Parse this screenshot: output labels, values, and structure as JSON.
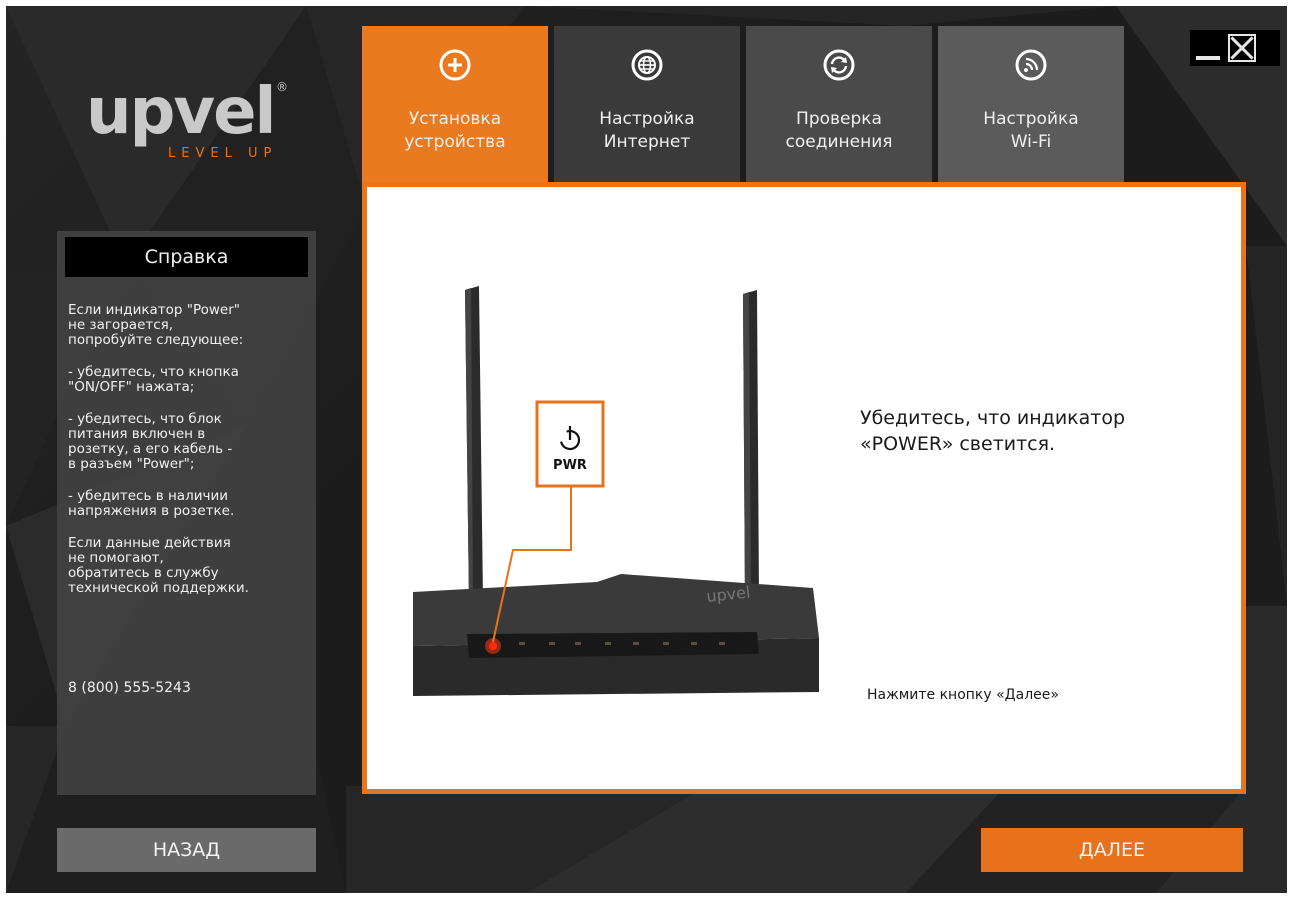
{
  "window": {
    "minimize_icon": "minimize-icon",
    "close_icon": "close-icon"
  },
  "logo": {
    "word": "upvel",
    "registered": "®",
    "tagline": "LEVEL UP"
  },
  "tabs": [
    {
      "line1": "Установка",
      "line2": "устройства",
      "icon": "plus-circle-icon",
      "active": true,
      "color": "#ea7a1f"
    },
    {
      "line1": "Настройка",
      "line2": "Интернет",
      "icon": "globe-icon",
      "active": false,
      "color": "#3a3a3a"
    },
    {
      "line1": "Проверка",
      "line2": "соединения",
      "icon": "refresh-icon",
      "active": false,
      "color": "#4a4a4a"
    },
    {
      "line1": "Настройка",
      "line2": "Wi-Fi",
      "icon": "wifi-icon",
      "active": false,
      "color": "#5b5b5b"
    }
  ],
  "help": {
    "title": "Справка",
    "paragraphs": [
      "Если индикатор \"Power\"\nне загорается,\nпопробуйте следующее:",
      "- убедитесь, что кнопка\n\"ON/OFF\" нажата;",
      "- убедитесь, что блок\nпитания включен в\nрозетку, а его кабель -\nв разъем \"Power\";",
      "- убедитесь в наличии\nнапряжения в розетке.",
      "Если данные действия\nне помогают,\nобратитесь в службу\nтехнической поддержки."
    ],
    "phone": "8 (800) 555-5243"
  },
  "content": {
    "router_label": "PWR",
    "router_brand": "upvel",
    "main_line1": "Убедитесь, что индикатор",
    "main_line2": "«POWER» светится.",
    "hint": "Нажмите кнопку «Далее»"
  },
  "buttons": {
    "back": "НАЗАД",
    "next": "ДАЛЕЕ"
  },
  "colors": {
    "accent": "#e8721c",
    "background": "#1c1c1c",
    "help_panel": "#464646"
  }
}
